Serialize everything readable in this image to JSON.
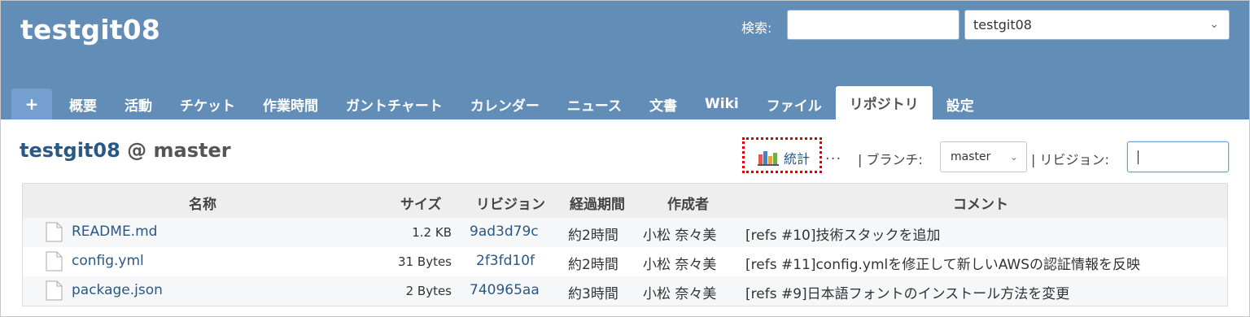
{
  "header": {
    "project_title": "testgit08",
    "search_label": "検索:",
    "search_value": "",
    "project_select_value": "testgit08"
  },
  "menu": {
    "plus_label": "+",
    "tabs": [
      {
        "label": "概要"
      },
      {
        "label": "活動"
      },
      {
        "label": "チケット"
      },
      {
        "label": "作業時間"
      },
      {
        "label": "ガントチャート"
      },
      {
        "label": "カレンダー"
      },
      {
        "label": "ニュース"
      },
      {
        "label": "文書"
      },
      {
        "label": "Wiki"
      },
      {
        "label": "ファイル"
      },
      {
        "label": "リポジトリ",
        "active": true
      },
      {
        "label": "設定"
      }
    ]
  },
  "repo": {
    "name": "testgit08",
    "separator": "@",
    "branch": "master"
  },
  "toolbar": {
    "stats_label": "統計",
    "more_label": "...",
    "branch_label": "| ブランチ:",
    "branch_value": "master",
    "revision_label": "| リビジョン:",
    "revision_value": ""
  },
  "table": {
    "headers": {
      "name": "名称",
      "size": "サイズ",
      "revision": "リビジョン",
      "age": "経過期間",
      "author": "作成者",
      "comment": "コメント"
    },
    "rows": [
      {
        "name": "README.md",
        "size": "1.2 KB",
        "revision": "9ad3d79c",
        "age": "約2時間",
        "author": "小松 奈々美",
        "comment": "[refs #10]技術スタックを追加"
      },
      {
        "name": "config.yml",
        "size": "31 Bytes",
        "revision": "2f3fd10f",
        "age": "約2時間",
        "author": "小松 奈々美",
        "comment": "[refs #11]config.ymlを修正して新しいAWSの認証情報を反映"
      },
      {
        "name": "package.json",
        "size": "2 Bytes",
        "revision": "740965aa",
        "age": "約3時間",
        "author": "小松 奈々美",
        "comment": "[refs #9]日本語フォントのインストール方法を変更"
      }
    ]
  },
  "colors": {
    "header_bg": "#628db6",
    "link": "#2a5885",
    "highlight_border": "#e00000"
  }
}
